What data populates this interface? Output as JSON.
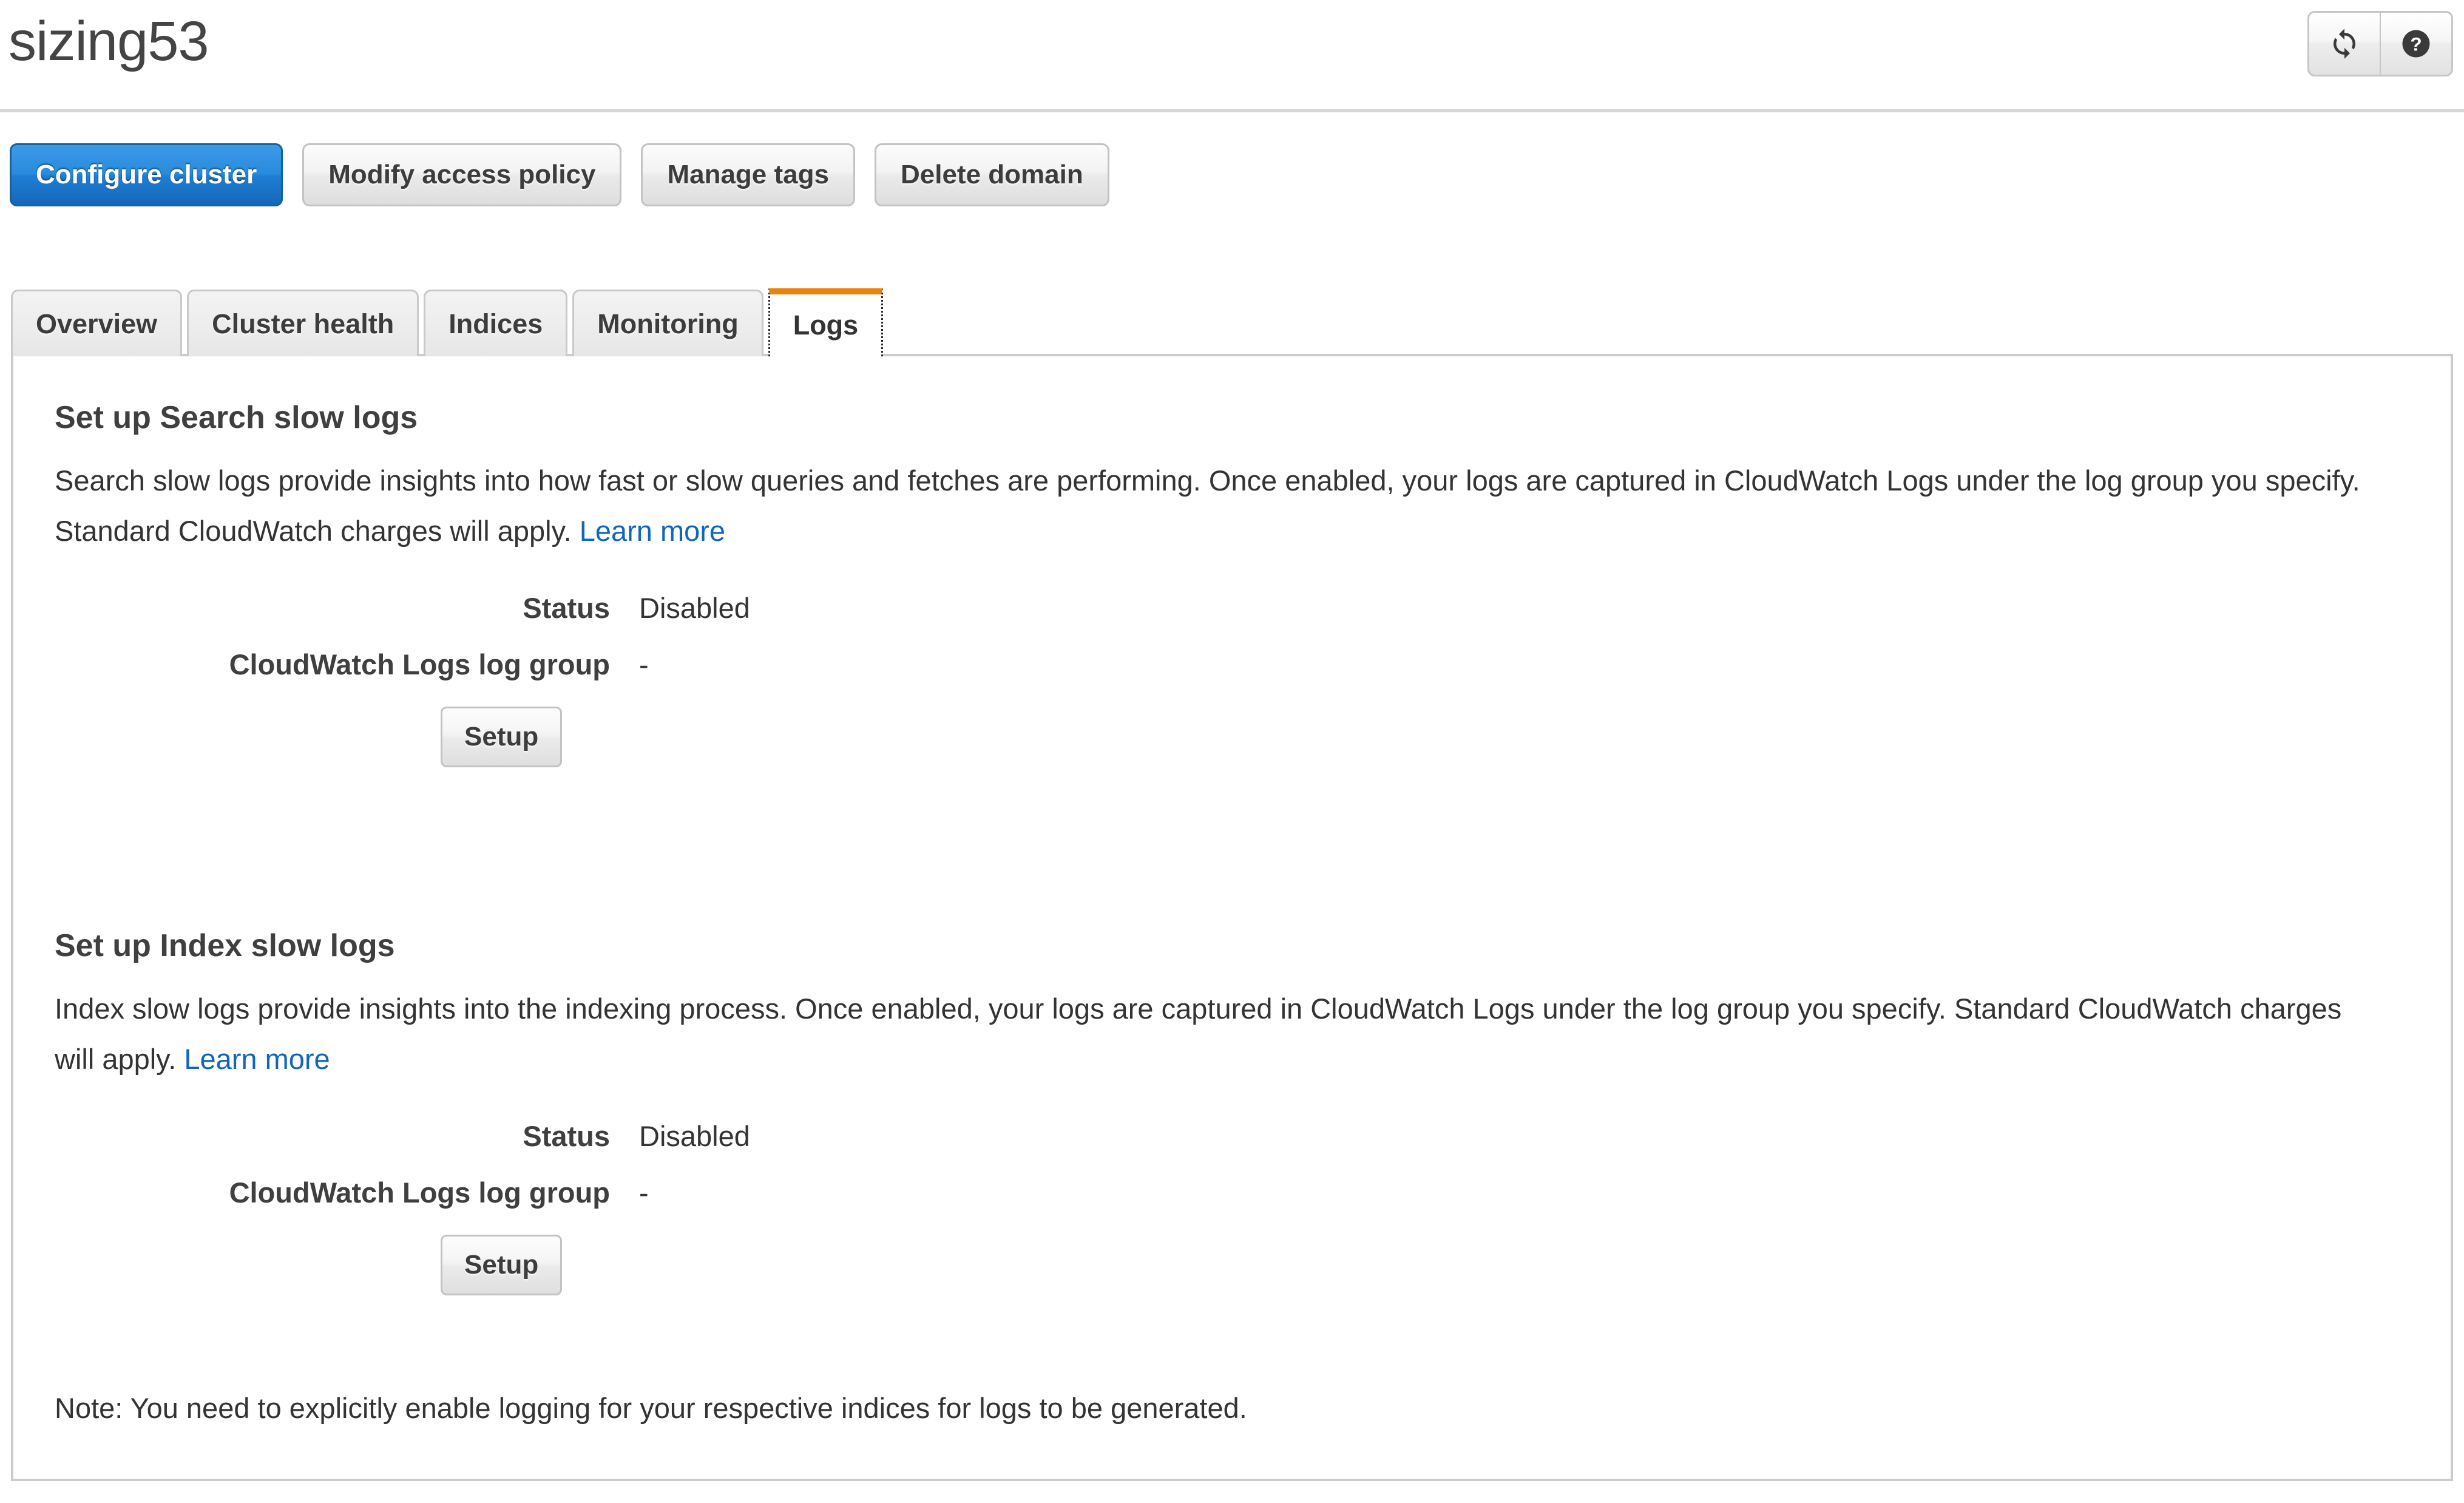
{
  "header": {
    "title": "sizing53",
    "refresh_icon": "refresh-icon",
    "help_icon": "help-icon"
  },
  "actions": {
    "configure_cluster": "Configure cluster",
    "modify_access_policy": "Modify access policy",
    "manage_tags": "Manage tags",
    "delete_domain": "Delete domain"
  },
  "tabs": [
    {
      "label": "Overview",
      "active": false
    },
    {
      "label": "Cluster health",
      "active": false
    },
    {
      "label": "Indices",
      "active": false
    },
    {
      "label": "Monitoring",
      "active": false
    },
    {
      "label": "Logs",
      "active": true
    }
  ],
  "sections": [
    {
      "title": "Set up Search slow logs",
      "description": "Search slow logs provide insights into how fast or slow queries and fetches are performing. Once enabled, your logs are captured in CloudWatch Logs under the log group you specify. Standard CloudWatch charges will apply.",
      "learn_more": "Learn more",
      "status_label": "Status",
      "status_value": "Disabled",
      "log_group_label": "CloudWatch Logs log group",
      "log_group_value": "-",
      "setup_button": "Setup"
    },
    {
      "title": "Set up Index slow logs",
      "description": "Index slow logs provide insights into the indexing process. Once enabled, your logs are captured in CloudWatch Logs under the log group you specify. Standard CloudWatch charges will apply.",
      "learn_more": "Learn more",
      "status_label": "Status",
      "status_value": "Disabled",
      "log_group_label": "CloudWatch Logs log group",
      "log_group_value": "-",
      "setup_button": "Setup"
    }
  ],
  "note": "Note: You need to explicitly enable logging for your respective indices for logs to be generated.",
  "colors": {
    "primary_button": "#1d7fd4",
    "link": "#1166bb",
    "active_tab_accent": "#e8820c",
    "panel_border": "#cccccc"
  }
}
